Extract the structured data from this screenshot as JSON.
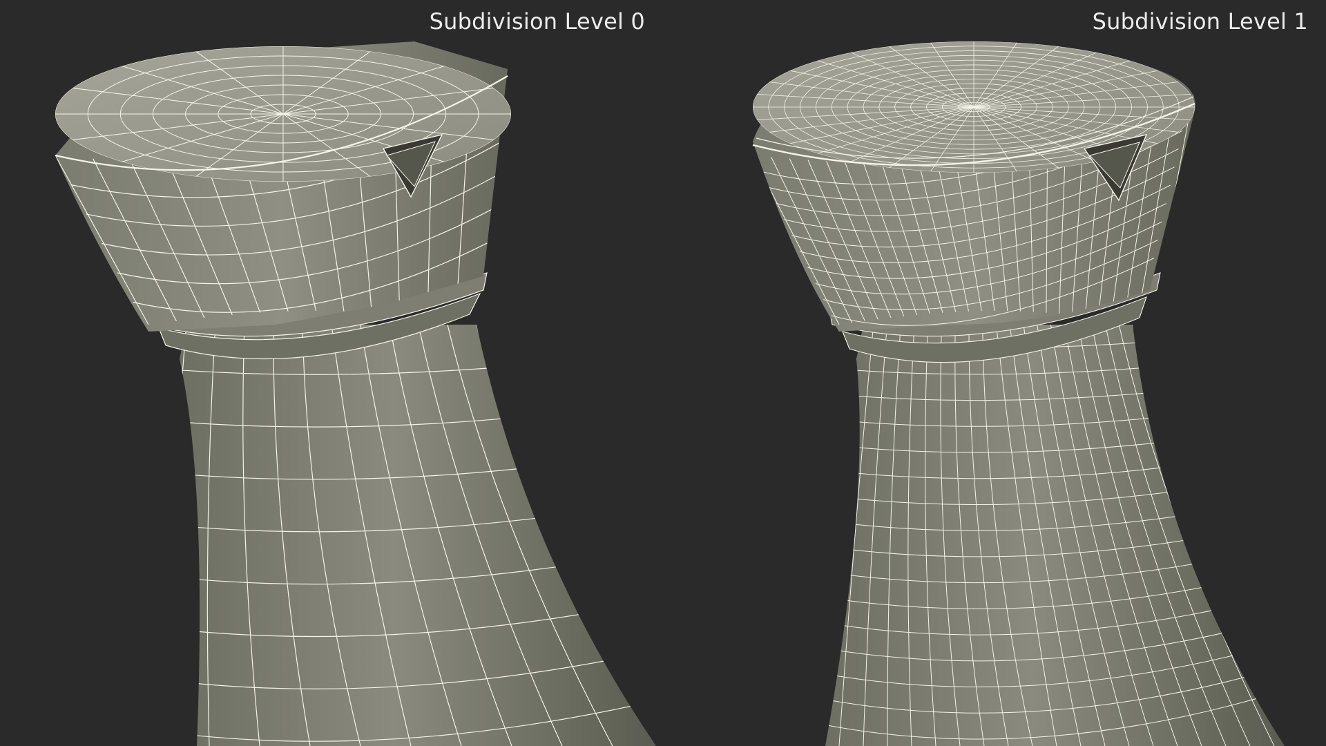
{
  "viewports": [
    {
      "title": "Subdivision Level 0",
      "density": 1
    },
    {
      "title": "Subdivision Level 1",
      "density": 2
    }
  ],
  "colors": {
    "background": "#2a2a2a",
    "surface_light": "#8e8f82",
    "surface_dark": "#56574c",
    "wire": "#f4f4ea",
    "label": "#ebebeb"
  }
}
